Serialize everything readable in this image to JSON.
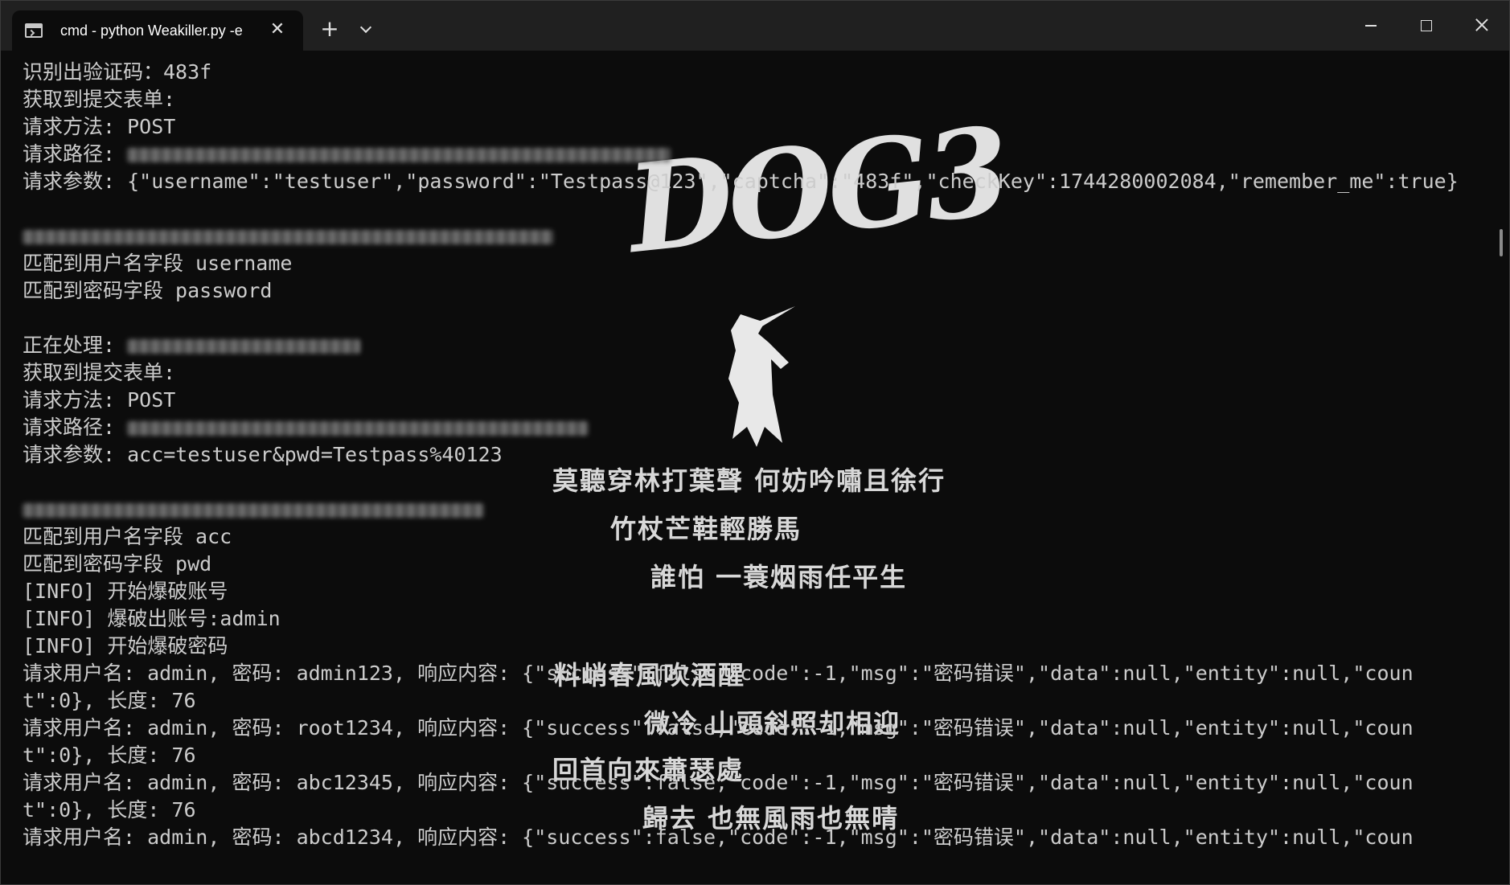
{
  "window": {
    "tab_title": "cmd - python  Weakiller.py -e",
    "tab_close_glyph": "✕",
    "new_tab_glyph": "+"
  },
  "background": {
    "logo": "DOG3",
    "poem": [
      "莫聽穿林打葉聲  何妨吟嘯且徐行",
      "竹杖芒鞋輕勝馬",
      "誰怕  一蓑烟雨任平生",
      "料峭春風吹酒醒",
      "微冷  山頭斜照却相迎",
      "回首向來蕭瑟處",
      "歸去  也無風雨也無晴"
    ]
  },
  "terminal": {
    "lines": [
      "识别出验证码：483f",
      "获取到提交表单:",
      "请求方法: POST",
      "请求路径: ",
      "请求参数: {\"username\":\"testuser\",\"password\":\"Testpass@123\",\"captcha\":\"483f\",\"checkKey\":1744280002084,\"remember_me\":true}",
      "",
      "",
      "匹配到用户名字段 username",
      "匹配到密码字段 password",
      "",
      "正在处理: ",
      "获取到提交表单:",
      "请求方法: POST",
      "请求路径: ",
      "请求参数: acc=testuser&pwd=Testpass%40123",
      "",
      "",
      "匹配到用户名字段 acc",
      "匹配到密码字段 pwd",
      "[INFO] 开始爆破账号",
      "[INFO] 爆破出账号:admin",
      "[INFO] 开始爆破密码",
      "请求用户名: admin, 密码: admin123, 响应内容: {\"success\":false,\"code\":-1,\"msg\":\"密码错误\",\"data\":null,\"entity\":null,\"coun",
      "t\":0}, 长度: 76",
      "请求用户名: admin, 密码: root1234, 响应内容: {\"success\":false,\"code\":-1,\"msg\":\"密码错误\",\"data\":null,\"entity\":null,\"coun",
      "t\":0}, 长度: 76",
      "请求用户名: admin, 密码: abc12345, 响应内容: {\"success\":false,\"code\":-1,\"msg\":\"密码错误\",\"data\":null,\"entity\":null,\"coun",
      "t\":0}, 长度: 76",
      "请求用户名: admin, 密码: abcd1234, 响应内容: {\"success\":false,\"code\":-1,\"msg\":\"密码错误\",\"data\":null,\"entity\":null,\"coun"
    ]
  }
}
